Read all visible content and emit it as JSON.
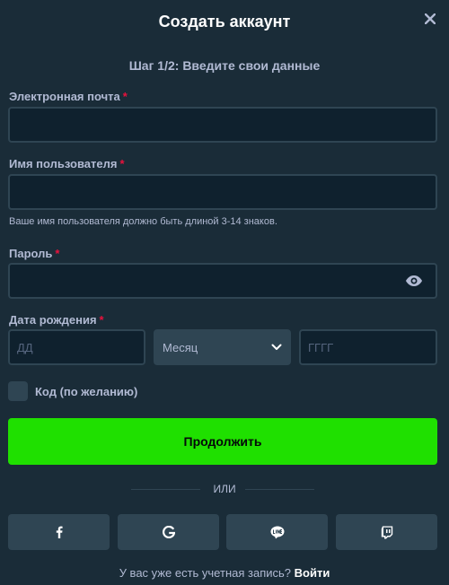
{
  "header": {
    "title": "Создать аккаунт",
    "step": "Шаг 1/2: Введите свои данные"
  },
  "email": {
    "label": "Электронная почта",
    "required_mark": "*",
    "value": "",
    "placeholder": ""
  },
  "username": {
    "label": "Имя пользователя",
    "required_mark": "*",
    "value": "",
    "placeholder": "",
    "hint": "Ваше имя пользователя должно быть длиной 3-14 знаков."
  },
  "password": {
    "label": "Пароль",
    "required_mark": "*",
    "value": "",
    "placeholder": "",
    "toggle_icon": "eye-icon"
  },
  "birthdate": {
    "label": "Дата рождения",
    "required_mark": "*",
    "day_placeholder": "ДД",
    "month_value": "Месяц",
    "year_placeholder": "ГГГГ"
  },
  "promo": {
    "label": "Код (по желанию)",
    "checked": false
  },
  "continue_label": "Продолжить",
  "divider_label": "ИЛИ",
  "social": [
    {
      "name": "facebook",
      "icon": "facebook-icon"
    },
    {
      "name": "google",
      "icon": "google-icon"
    },
    {
      "name": "line",
      "icon": "line-icon"
    },
    {
      "name": "twitch",
      "icon": "twitch-icon"
    }
  ],
  "footer": {
    "prompt": "У вас уже есть учетная запись?",
    "login_label": "Войти"
  },
  "colors": {
    "background": "#1a2c38",
    "input_bg": "#0f212e",
    "border": "#2f4553",
    "accent": "#1fe000",
    "required": "#e9113c",
    "muted_text": "#b1bad3"
  }
}
